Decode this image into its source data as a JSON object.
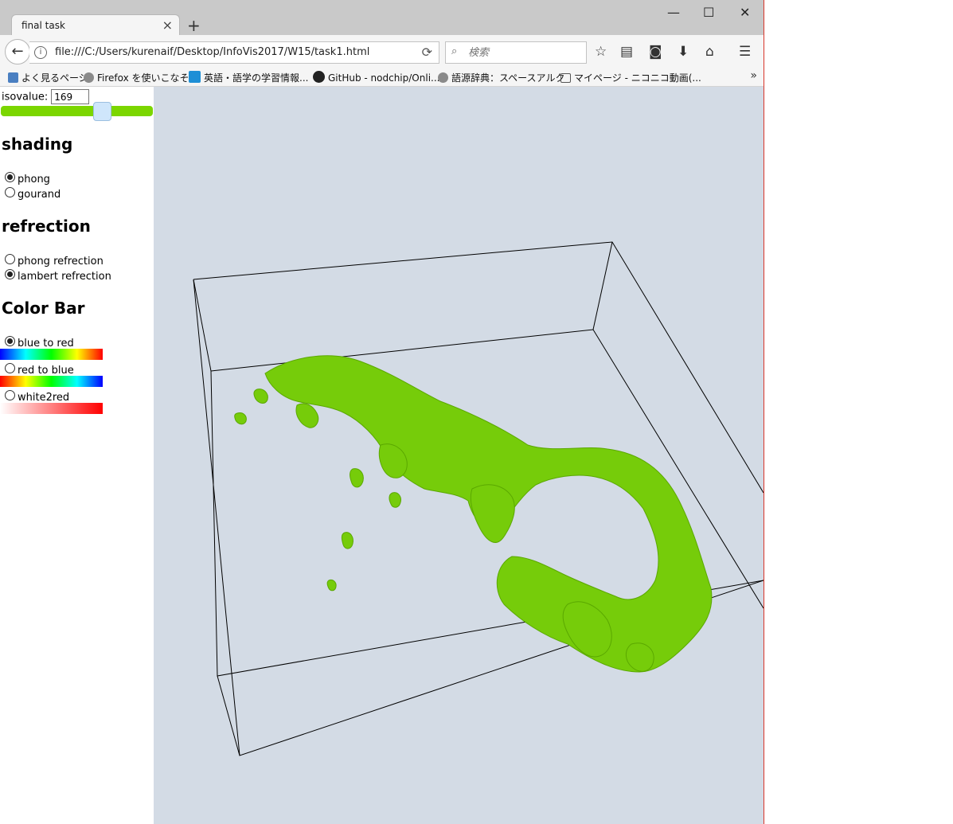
{
  "browser": {
    "tab_title": "final task",
    "tab_close": "×",
    "new_tab": "+",
    "window_controls": {
      "minimize": "—",
      "maximize": "☐",
      "close": "✕"
    },
    "back": "←",
    "info": "i",
    "url": "file:///C:/Users/kurenaif/Desktop/InfoVis2017/W15/task1.html",
    "reload": "⟳",
    "search_placeholder": "検索",
    "toolbar_icons": [
      "star-icon",
      "reading-list-icon",
      "pocket-icon",
      "download-icon",
      "home-icon",
      "menu-icon"
    ],
    "toolbar_glyphs": {
      "star": "☆",
      "reading": "▤",
      "pocket": "◙",
      "download": "⬇",
      "home": "⌂",
      "menu": "☰"
    },
    "bookmarks": [
      {
        "label": "よく見るページ",
        "icon": "most-visited-icon",
        "color": "#4a7fc1"
      },
      {
        "label": "Firefox を使いこなそう",
        "icon": "globe-icon",
        "color": "#8a8a8a"
      },
      {
        "label": "英語・語学の学習情報...",
        "icon": "alc-icon",
        "color": "#1e8fd6"
      },
      {
        "label": "GitHub - nodchip/Onli...",
        "icon": "github-icon",
        "color": "#222222"
      },
      {
        "label": "語源辞典：スペースアルク",
        "icon": "globe-icon",
        "color": "#8a8a8a"
      },
      {
        "label": "マイページ - ニコニコ動画(...",
        "icon": "tv-icon",
        "color": "#555555"
      }
    ],
    "bookmarks_more": "»"
  },
  "controls": {
    "iso_label": "isovalue:",
    "iso_value": "169",
    "slider_level": 0.66,
    "slider_color": "#7bd600",
    "shading_heading": "shading",
    "shading_options": [
      "phong",
      "gourand"
    ],
    "shading_selected": 0,
    "refrection_heading": "refrection",
    "refrection_options": [
      "phong refrection",
      "lambert refrection"
    ],
    "refrection_selected": 1,
    "colorbar_heading": "Color Bar",
    "colorbar_options": [
      "blue to red",
      "red to blue",
      "white2red"
    ],
    "colorbar_selected": 0
  },
  "viewport": {
    "background": "#d3dbe5",
    "surface_color": "#76cc0a",
    "box_color": "#000000"
  }
}
